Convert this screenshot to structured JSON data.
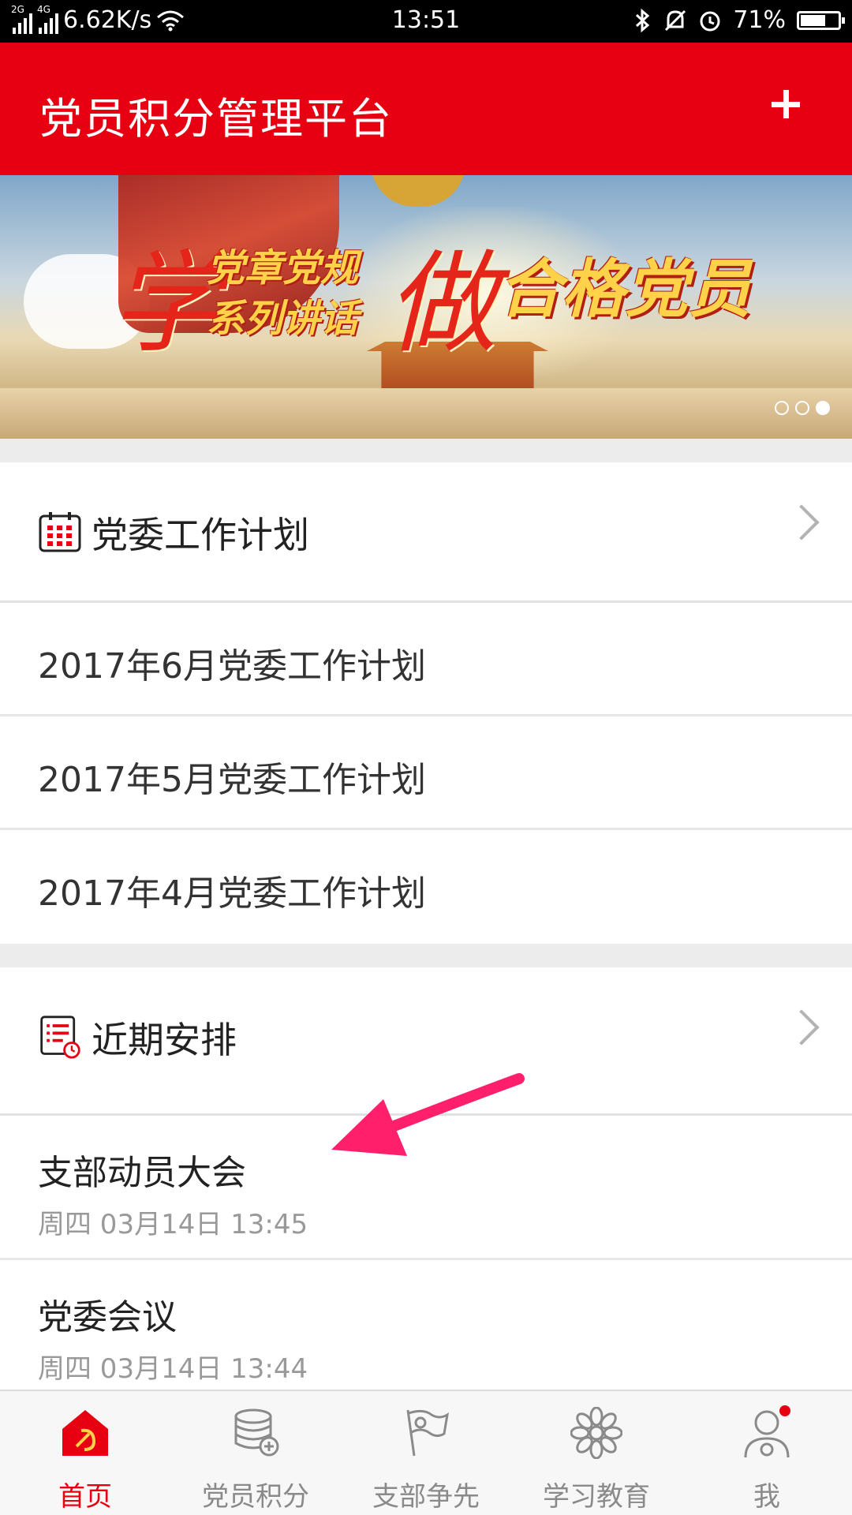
{
  "status_bar": {
    "network_1": "2G",
    "network_2": "4G",
    "speed": "6.62K/s",
    "time": "13:51",
    "battery": "71%",
    "battery_level": 0.71,
    "icons": [
      "signal-icon",
      "wifi-icon",
      "bluetooth-icon",
      "mute-icon",
      "alarm-icon",
      "battery-icon"
    ]
  },
  "header": {
    "title": "党员积分管理平台",
    "add_icon": "plus-icon"
  },
  "banner": {
    "char_1": "学",
    "line_1": "党章党规",
    "line_2": "系列讲话",
    "char_2": "做",
    "slogan": "合格党员",
    "slides": 3,
    "active_slide": 3
  },
  "work_plan": {
    "icon": "calendar-icon",
    "title": "党委工作计划",
    "items": [
      {
        "label": "2017年6月党委工作计划"
      },
      {
        "label": "2017年5月党委工作计划"
      },
      {
        "label": "2017年4月党委工作计划"
      }
    ]
  },
  "schedule": {
    "icon": "schedule-list-icon",
    "title": "近期安排",
    "items": [
      {
        "title": "支部动员大会",
        "time": "周四  03月14日 13:45"
      },
      {
        "title": "党委会议",
        "time": "周四  03月14日 13:44"
      }
    ]
  },
  "tabbar": {
    "tabs": [
      {
        "label": "首页",
        "icon": "party-home-icon",
        "active": true
      },
      {
        "label": "党员积分",
        "icon": "coins-icon",
        "active": false
      },
      {
        "label": "支部争先",
        "icon": "flag-icon",
        "active": false
      },
      {
        "label": "学习教育",
        "icon": "flower-icon",
        "active": false
      },
      {
        "label": "我",
        "icon": "user-icon",
        "active": false,
        "badge": true
      }
    ]
  },
  "colors": {
    "brand_red": "#e60012",
    "arrow_pink": "#ff1f6a"
  }
}
